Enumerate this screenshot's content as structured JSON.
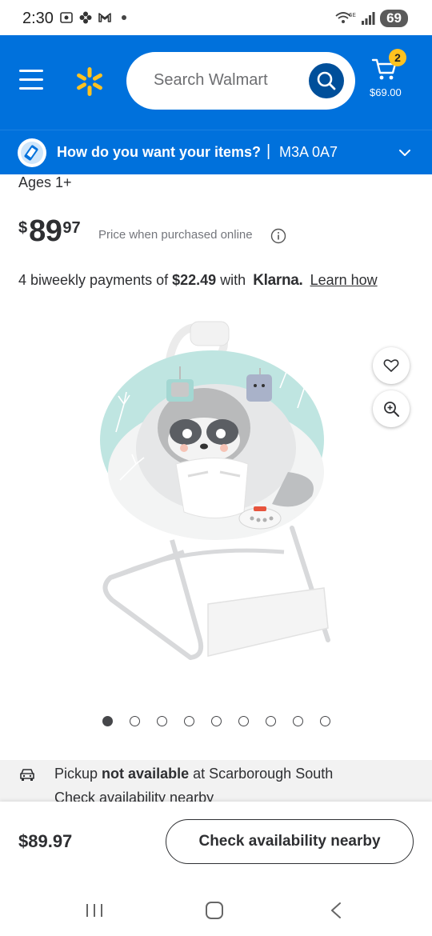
{
  "status_bar": {
    "time": "2:30",
    "battery": "69"
  },
  "header": {
    "search_placeholder": "Search Walmart",
    "cart_count": "2",
    "cart_total": "$69.00"
  },
  "delivery": {
    "question": "How do you want your items?",
    "separator": "|",
    "postal_code": "M3A 0A7"
  },
  "product": {
    "ages": "Ages 1+",
    "price_symbol": "$",
    "price_dollars": "89",
    "price_cents": "97",
    "price_note": "Price when purchased online",
    "klarna": {
      "prefix": "4 biweekly payments of",
      "amount": "$22.49",
      "with": "with",
      "brand": "Klarna.",
      "learn_how": "Learn how"
    },
    "carousel": {
      "total": 9,
      "active": 0
    }
  },
  "pickup": {
    "label": "Pickup",
    "status": "not available",
    "location": "at Scarborough South",
    "link": "Check availability nearby"
  },
  "action_bar": {
    "price": "$89.97",
    "button_label": "Check availability nearby"
  },
  "colors": {
    "walmart_blue": "#0071dc",
    "search_button": "#004f9a",
    "spark_yellow": "#ffc220",
    "bouncer_teal": "#bfe5e1"
  }
}
